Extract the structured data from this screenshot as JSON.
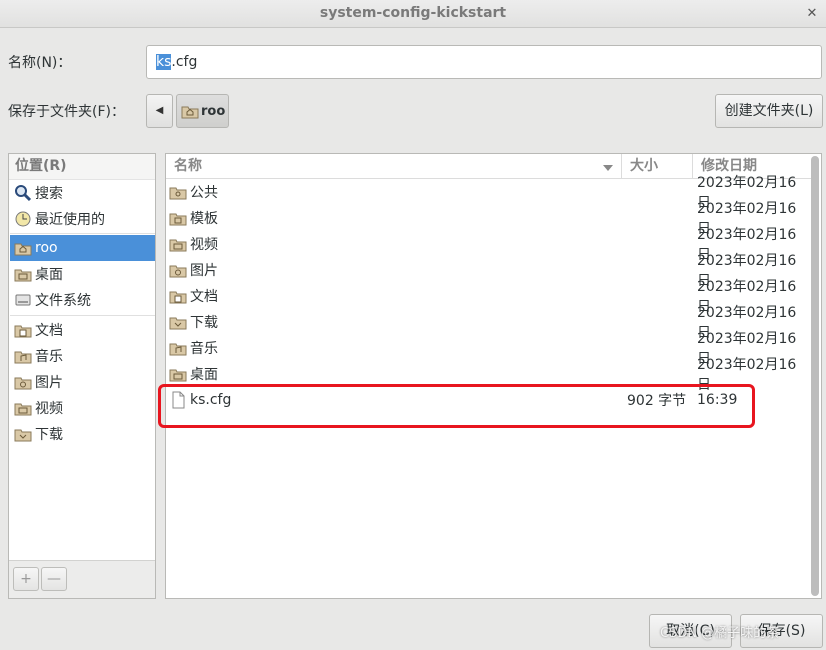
{
  "window": {
    "title": "system-config-kickstart"
  },
  "name_row": {
    "label": "名称(N)：",
    "value_selected": "ks",
    "value_rest": ".cfg"
  },
  "folder_row": {
    "label": "保存于文件夹(F)：",
    "path": "roo",
    "create_folder_label": "创建文件夹(L)"
  },
  "places": {
    "header": "位置(R)",
    "items": [
      {
        "label": "搜索",
        "icon": "search-icon"
      },
      {
        "label": "最近使用的",
        "icon": "recent-icon"
      },
      {
        "label": "roo",
        "icon": "home-folder-icon",
        "selected": true
      },
      {
        "label": "桌面",
        "icon": "folder-icon"
      },
      {
        "label": "文件系统",
        "icon": "drive-icon"
      },
      {
        "label": "文档",
        "icon": "folder-icon"
      },
      {
        "label": "音乐",
        "icon": "folder-icon"
      },
      {
        "label": "图片",
        "icon": "folder-icon"
      },
      {
        "label": "视频",
        "icon": "folder-icon"
      },
      {
        "label": "下载",
        "icon": "folder-icon"
      }
    ],
    "add_label": "+",
    "remove_label": "—"
  },
  "files": {
    "columns": {
      "name": "名称",
      "size": "大小",
      "modified": "修改日期"
    },
    "rows": [
      {
        "name": "公共",
        "size": "",
        "modified": "2023年02月16日",
        "type": "folder"
      },
      {
        "name": "模板",
        "size": "",
        "modified": "2023年02月16日",
        "type": "folder"
      },
      {
        "name": "视频",
        "size": "",
        "modified": "2023年02月16日",
        "type": "folder"
      },
      {
        "name": "图片",
        "size": "",
        "modified": "2023年02月16日",
        "type": "folder"
      },
      {
        "name": "文档",
        "size": "",
        "modified": "2023年02月16日",
        "type": "folder"
      },
      {
        "name": "下载",
        "size": "",
        "modified": "2023年02月16日",
        "type": "folder"
      },
      {
        "name": "音乐",
        "size": "",
        "modified": "2023年02月16日",
        "type": "folder"
      },
      {
        "name": "桌面",
        "size": "",
        "modified": "2023年02月16日",
        "type": "folder"
      },
      {
        "name": "ks.cfg",
        "size": "902 字节",
        "modified": "16:39",
        "type": "file"
      }
    ]
  },
  "actions": {
    "cancel_label": "取消(C)",
    "save_label": "保存(S)"
  },
  "watermark": "CSDN @橘子味的茶",
  "colors": {
    "selection": "#4a90d9",
    "highlight_box": "#e8151f"
  }
}
